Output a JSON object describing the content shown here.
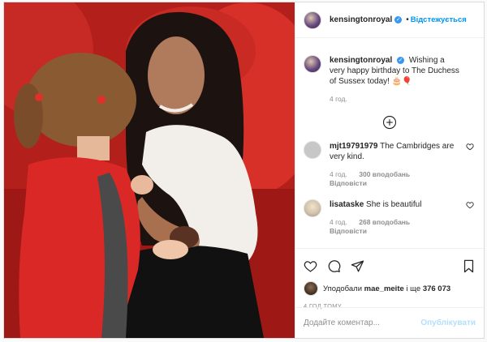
{
  "post": {
    "username": "kensingtonroyal",
    "follow_label": "Відстежується",
    "caption": "Wishing a very happy birthday to The Duchess of Sussex today! 🎂🎈",
    "caption_time": "4 год."
  },
  "comments": [
    {
      "username": "mjt19791979",
      "text": "The Cambridges are very kind.",
      "time": "4 год.",
      "likes": "300 вподобань",
      "reply": "Відповісти"
    },
    {
      "username": "lisataske",
      "text": "She is beautiful",
      "time": "4 год.",
      "likes": "268 вподобань",
      "reply": "Відповісти"
    }
  ],
  "likes": {
    "prefix": "Уподобали",
    "user": "mae_meite",
    "suffix": "і ще",
    "count": "376 073"
  },
  "post_time": "4 ГОД ТОМУ",
  "add_comment": {
    "placeholder": "Додайте коментар...",
    "publish": "Опублікувати"
  },
  "colors": {
    "accent": "#0095f6",
    "verified": "#3897f0",
    "publish_disabled": "#b2dffc"
  },
  "icons": [
    "heart-icon",
    "comment-icon",
    "share-icon",
    "bookmark-icon",
    "add-comment-icon",
    "verified-icon"
  ]
}
